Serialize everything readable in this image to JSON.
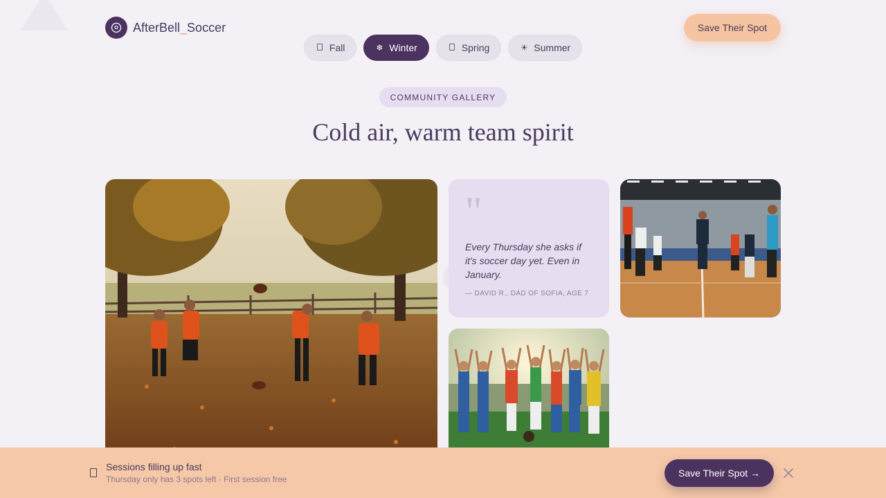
{
  "brand": {
    "name_main": "AfterBell",
    "name_sep": "_",
    "name_tail": "Soccer",
    "logo_icon": "soccer-ball-icon"
  },
  "header": {
    "cta_label": "Save Their Spot"
  },
  "seasons": [
    {
      "label": "Fall",
      "icon": "leaf-icon",
      "active": false
    },
    {
      "label": "Winter",
      "icon": "snowflake-icon",
      "active": true
    },
    {
      "label": "Spring",
      "icon": "flower-icon",
      "active": false
    },
    {
      "label": "Summer",
      "icon": "sun-icon",
      "active": false
    }
  ],
  "section": {
    "eyebrow": "COMMUNITY GALLERY",
    "headline": "Cold air, warm team spirit"
  },
  "gallery": {
    "quote": {
      "text": "Every Thursday she asks if it's soccer day yet. Even in January.",
      "author": "— DAVID R., DAD OF SOFIA, AGE 7"
    },
    "photos": [
      {
        "id": "fall-park",
        "subject": "kids playing catch in autumn park"
      },
      {
        "id": "indoor-futsal",
        "subject": "indoor futsal training"
      },
      {
        "id": "team-celebration",
        "subject": "team raising arms on pitch"
      }
    ]
  },
  "banner": {
    "title": "Sessions filling up fast",
    "subtitle": "Thursday only has 3 spots left · First session free",
    "cta_label": "Save Their Spot →"
  },
  "colors": {
    "primary": "#4b325f",
    "accent": "#f5c4a0",
    "background": "#f3f0f6",
    "chip": "#e6def0"
  }
}
